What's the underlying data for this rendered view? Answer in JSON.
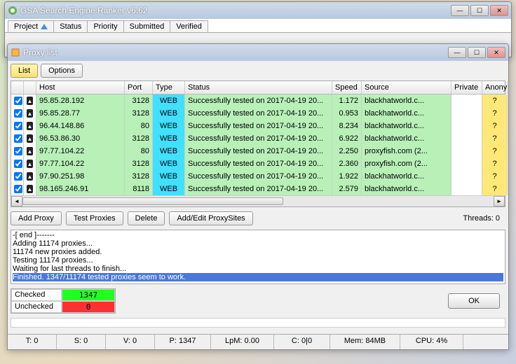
{
  "mainWindow": {
    "title": "GSA Search Engine Ranker v6.62",
    "tabs": [
      "Project",
      "Status",
      "Priority",
      "Submitted",
      "Verified"
    ]
  },
  "proxyWindow": {
    "title": "Proxy list",
    "listBtn": "List",
    "optionsBtn": "Options",
    "headers": {
      "host": "Host",
      "port": "Port",
      "type": "Type",
      "status": "Status",
      "speed": "Speed",
      "source": "Source",
      "private": "Private",
      "anon": "Anony..."
    },
    "rows": [
      {
        "host": "95.85.28.192",
        "port": "3128",
        "type": "WEB",
        "status": "Successfully tested on 2017-04-19 20...",
        "speed": "1.172",
        "source": "blackhatworld.c...",
        "anon": "?"
      },
      {
        "host": "95.85.28.77",
        "port": "3128",
        "type": "WEB",
        "status": "Successfully tested on 2017-04-19 20...",
        "speed": "0.953",
        "source": "blackhatworld.c...",
        "anon": "?"
      },
      {
        "host": "96.44.148.86",
        "port": "80",
        "type": "WEB",
        "status": "Successfully tested on 2017-04-19 20...",
        "speed": "8.234",
        "source": "blackhatworld.c...",
        "anon": "?"
      },
      {
        "host": "96.53.86.30",
        "port": "3128",
        "type": "WEB",
        "status": "Successfully tested on 2017-04-19 20...",
        "speed": "6.922",
        "source": "blackhatworld.c...",
        "anon": "?"
      },
      {
        "host": "97.77.104.22",
        "port": "80",
        "type": "WEB",
        "status": "Successfully tested on 2017-04-19 20...",
        "speed": "2.250",
        "source": "proxyfish.com (2...",
        "anon": "?"
      },
      {
        "host": "97.77.104.22",
        "port": "3128",
        "type": "WEB",
        "status": "Successfully tested on 2017-04-19 20...",
        "speed": "2.360",
        "source": "proxyfish.com (2...",
        "anon": "?"
      },
      {
        "host": "97.90.251.98",
        "port": "3128",
        "type": "WEB",
        "status": "Successfully tested on 2017-04-19 20...",
        "speed": "1.922",
        "source": "blackhatworld.c...",
        "anon": "?"
      },
      {
        "host": "98.165.246.91",
        "port": "8118",
        "type": "WEB",
        "status": "Successfully tested on 2017-04-19 20...",
        "speed": "2.579",
        "source": "blackhatworld.c...",
        "anon": "?"
      }
    ],
    "buttons": {
      "addProxy": "Add Proxy",
      "testProxies": "Test Proxies",
      "delete": "Delete",
      "addEdit": "Add/Edit ProxySites"
    },
    "threadsLabel": "Threads: 0",
    "log": [
      "-[ end ]-------",
      "Adding 11174 proxies...",
      "11174 new proxies added.",
      "Testing 11174 proxies...",
      "Waiting for last threads to finish...",
      "Finished. 1347/11174 tested proxies seem to work."
    ],
    "counts": {
      "checkedLabel": "Checked",
      "checkedVal": "1347",
      "uncheckedLabel": "Unchecked",
      "uncheckedVal": "0"
    },
    "okBtn": "OK"
  },
  "statusbar": {
    "t": "T: 0",
    "s": "S: 0",
    "v": "V: 0",
    "p": "P: 1347",
    "lpm": "LpM: 0.00",
    "c": "C: 0|0",
    "mem": "Mem: 84MB",
    "cpu": "CPU: 4%"
  }
}
